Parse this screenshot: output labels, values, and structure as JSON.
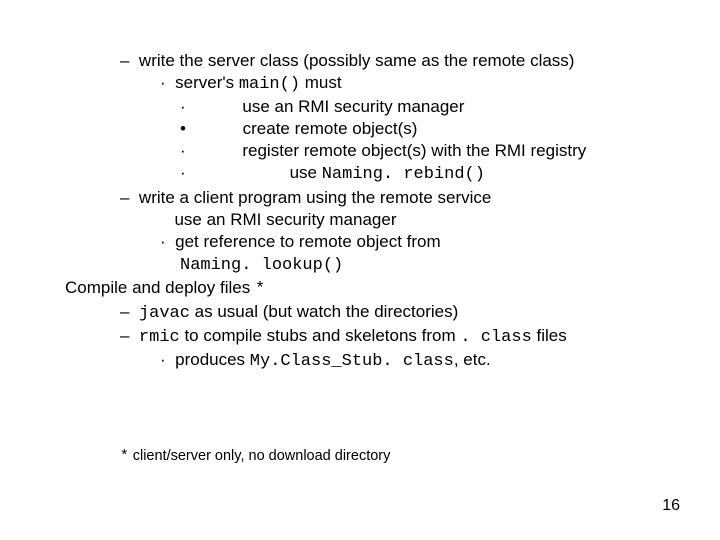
{
  "l1": {
    "dash": "–",
    "t1": "write the server class (possibly same as the remote class)"
  },
  "l2": {
    "dot": "·",
    "t1": "server's ",
    "code": "main()",
    "t2": " must"
  },
  "l3": {
    "dot": "·",
    "t1": "use an RMI security manager"
  },
  "l4": {
    "bull": "•",
    "t1": "create remote object(s)"
  },
  "l5": {
    "dot": "·",
    "t1": "register remote object(s) with the RMI registry"
  },
  "l6": {
    "dot": "·",
    "t1": "use ",
    "code": "Naming. rebind()"
  },
  "l7": {
    "dash": "–",
    "t1": "write a client program using the remote service"
  },
  "l8": {
    "t1": "use an RMI security manager"
  },
  "l9": {
    "dot": "·",
    "t1": "get reference to remote object from"
  },
  "l10": {
    "code": "Naming. lookup()"
  },
  "l11": {
    "t1": "Compile and deploy files ",
    "star": "*"
  },
  "l12": {
    "dash": "–",
    "code": "javac",
    "t1": " as usual (but watch the directories)"
  },
  "l13": {
    "dash": "–",
    "code": "rmic",
    "t1": " to compile stubs and skeletons from ",
    "code2": ". class",
    "t2": " files"
  },
  "l14": {
    "dot": "·",
    "t1": "produces ",
    "code": "My.Class_Stub. class",
    "t2": ", etc."
  },
  "footnote": {
    "star": "*",
    "t": " client/server only, no download directory"
  },
  "page": "16"
}
